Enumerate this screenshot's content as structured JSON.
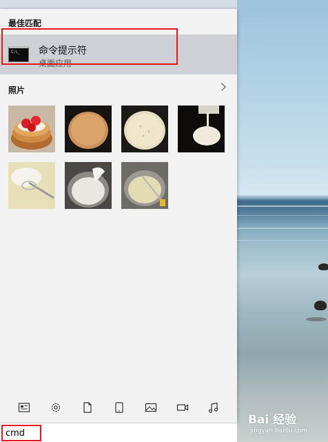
{
  "start_menu": {
    "best_match_title": "最佳匹配",
    "best_match": {
      "name": "命令提示符",
      "type": "桌面应用",
      "icon": "cmd-icon",
      "icon_text": "C:\\_"
    },
    "photos_title": "照片",
    "photos": [
      {
        "name": "pancakes-strawberries-photo"
      },
      {
        "name": "pancake-photo"
      },
      {
        "name": "pancake-batter-photo"
      },
      {
        "name": "pouring-batter-photo"
      },
      {
        "name": "whisk-cream-photo"
      },
      {
        "name": "whipped-cream-photo"
      },
      {
        "name": "whisk-batter-bowl-photo"
      }
    ],
    "filter_icons": [
      "news-icon",
      "settings-gear-icon",
      "document-icon",
      "tablet-icon",
      "image-icon",
      "video-icon",
      "music-icon"
    ]
  },
  "search": {
    "value": "cmd"
  },
  "watermark": {
    "main": "Bai 经验",
    "sub": "jingyan.baidu.com"
  },
  "colors": {
    "highlight": "#e8161b",
    "selected_row": "#cdd1d6",
    "panel": "#f2f2f2"
  }
}
